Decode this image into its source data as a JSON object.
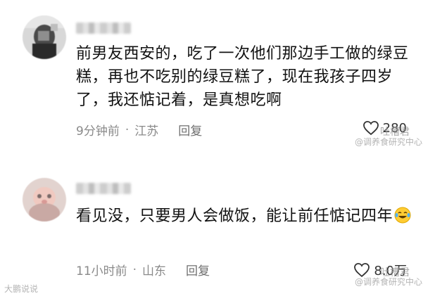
{
  "comments": [
    {
      "text": "前男友西安的，吃了一次他们那边手工做的绿豆糕，再也不吃别的绿豆糕了，现在我孩子四岁了，我还惦记着，是真想吃啊",
      "time": "9分钟前",
      "separator": "·",
      "location": "江苏",
      "reply_label": "回复",
      "likes": "280",
      "watermark_top": "吐槽君",
      "watermark_bottom": "@调养食研究中心"
    },
    {
      "text": "看见没，只要男人会做饭，能让前任惦记四年",
      "emoji": "laughing-with-tears-icon",
      "time": "11小时前",
      "separator": "·",
      "location": "山东",
      "reply_label": "回复",
      "likes": "8.0万",
      "watermark_top": "吐槽君",
      "watermark_bottom": "@调养食研究中心",
      "watermark_left": "大鹏说说"
    }
  ],
  "colors": {
    "text": "#111111",
    "meta": "#8a8a8a",
    "background": "#ffffff"
  }
}
